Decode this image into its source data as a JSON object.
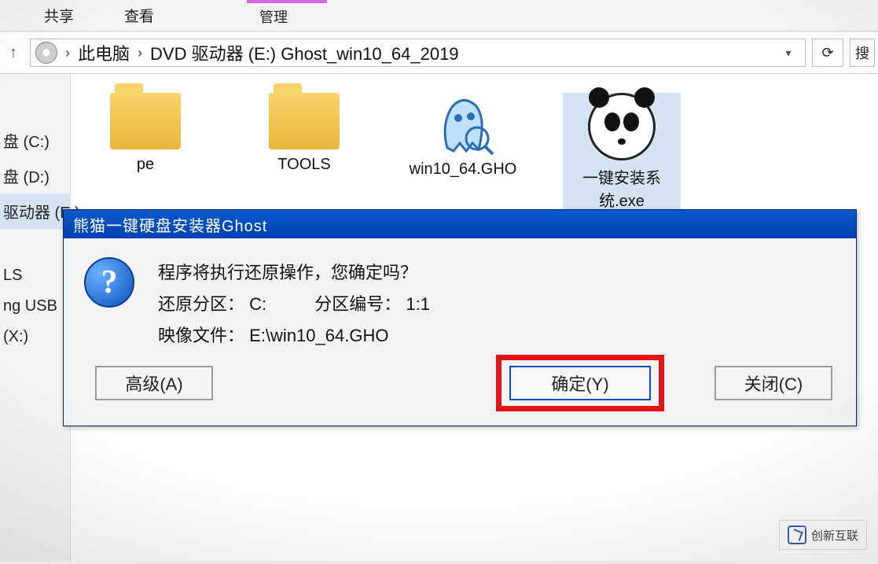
{
  "ribbon": {
    "tabs": [
      "共享",
      "查看"
    ],
    "manage": "管理"
  },
  "breadcrumb": {
    "root": "此电脑",
    "path": "DVD 驱动器 (E:) Ghost_win10_64_2019"
  },
  "search": {
    "placeholder": "搜"
  },
  "sidebar": {
    "items": [
      {
        "label": "盘 (C:)"
      },
      {
        "label": "盘 (D:)"
      },
      {
        "label": "驱动器 (E:)"
      },
      {
        "label": "LS"
      },
      {
        "label": "ng USB"
      },
      {
        "label": "(X:)"
      }
    ],
    "selected_index": 2
  },
  "files": [
    {
      "name": "pe",
      "type": "folder"
    },
    {
      "name": "TOOLS",
      "type": "folder"
    },
    {
      "name": "win10_64.GHO",
      "type": "gho"
    },
    {
      "name": "一键安装系统.exe",
      "type": "exe",
      "selected": true
    }
  ],
  "dialog": {
    "title": "熊猫一键硬盘安装器Ghost",
    "line1": "程序将执行还原操作，您确定吗？",
    "line2_label_a": "还原分区：",
    "line2_value_a": "C:",
    "line2_label_b": "分区编号：",
    "line2_value_b": "1:1",
    "line3_label": "映像文件：",
    "line3_value": "E:\\win10_64.GHO",
    "btn_adv": "高级(A)",
    "btn_ok": "确定(Y)",
    "btn_close": "关闭(C)"
  },
  "watermark": "创新互联"
}
